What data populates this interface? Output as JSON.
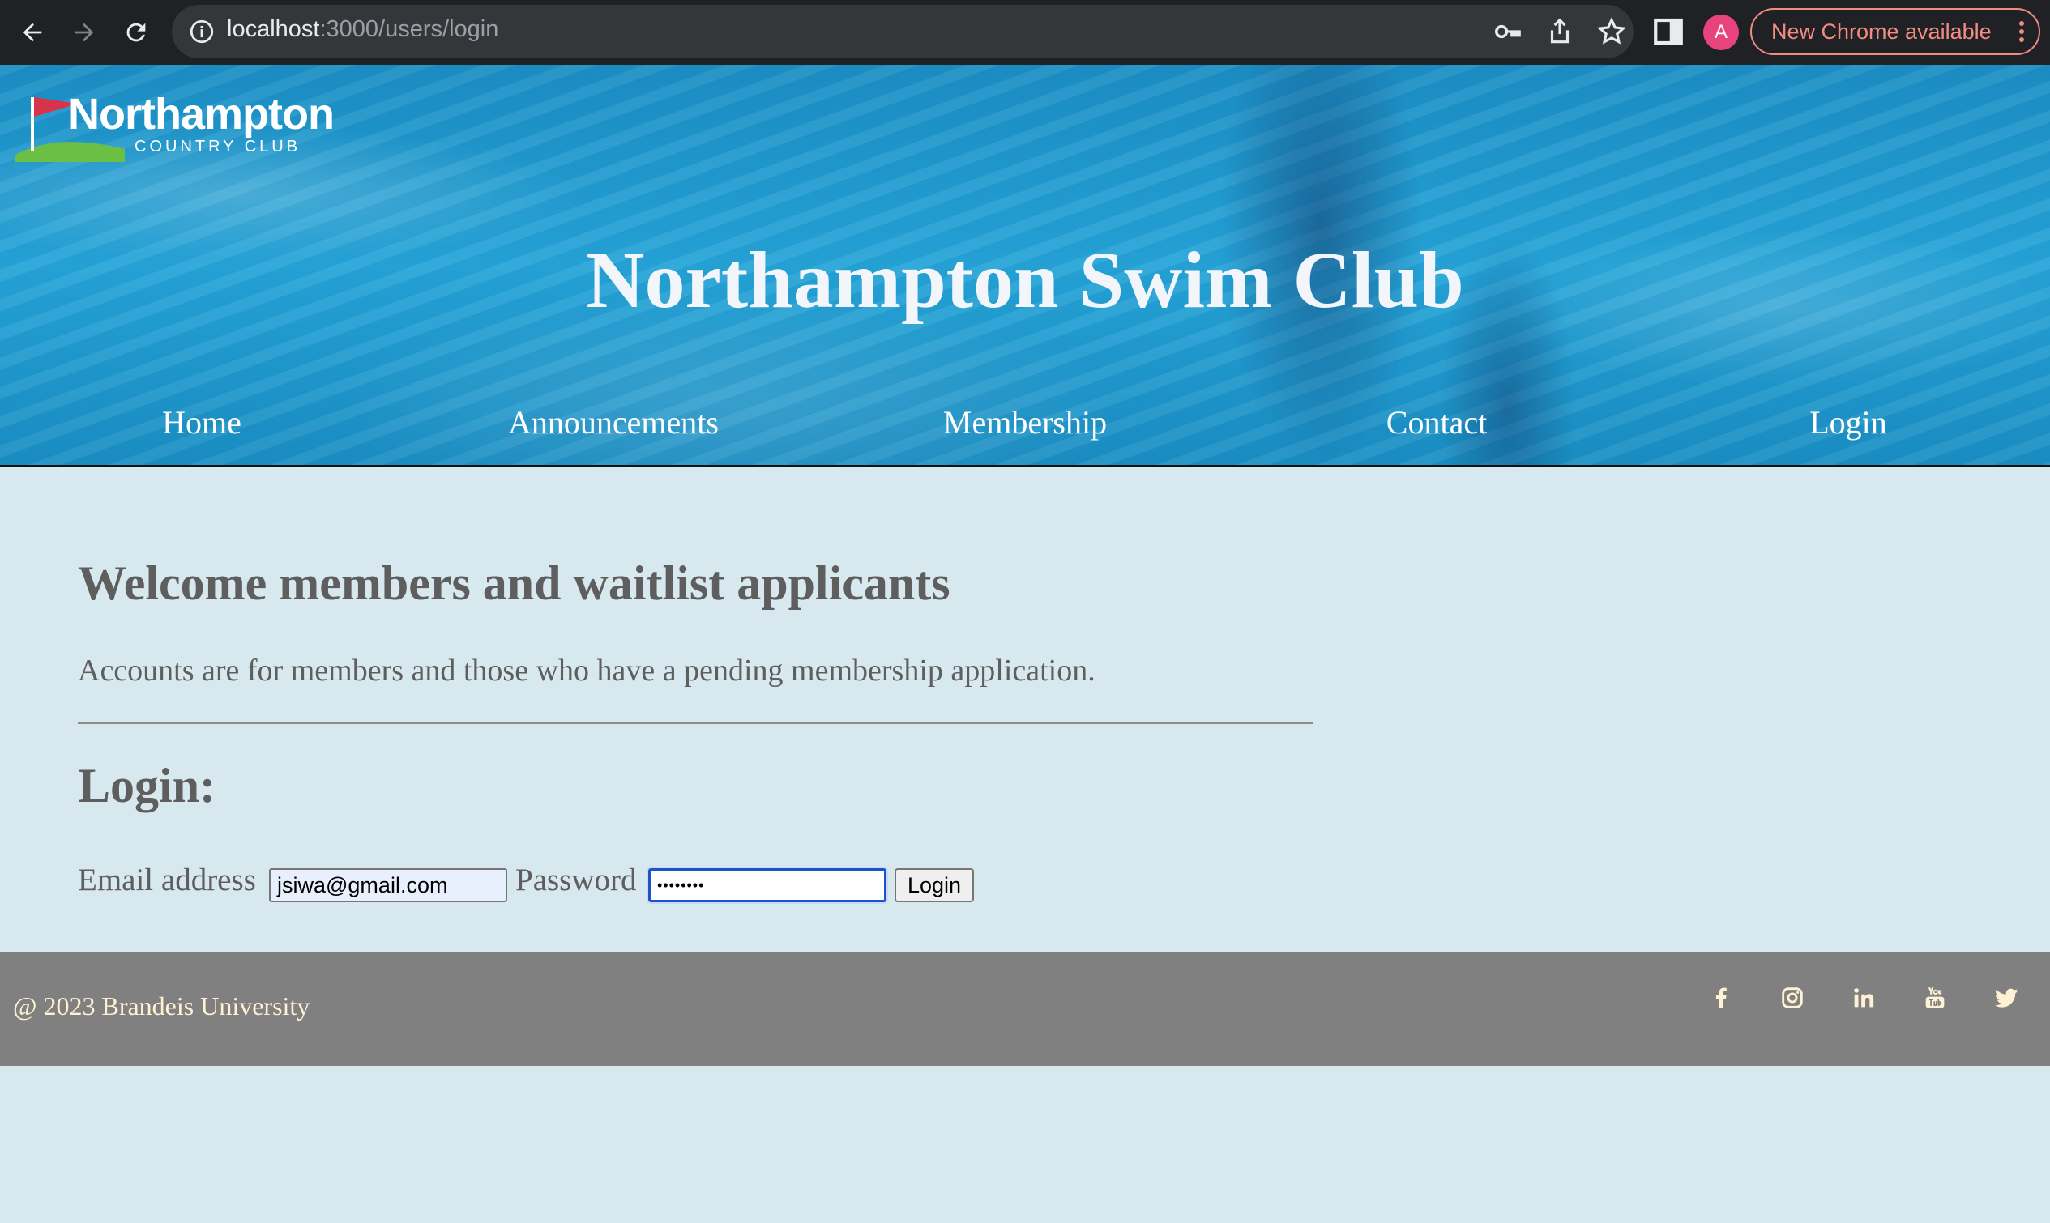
{
  "browser": {
    "url_host": "localhost",
    "url_path": ":3000/users/login",
    "profile_initial": "A",
    "update_label": "New Chrome available",
    "icons": [
      "back-icon",
      "forward-icon",
      "reload-icon",
      "info-icon",
      "key-icon",
      "share-icon",
      "star-icon",
      "side-panel-icon",
      "kebab-menu-icon"
    ]
  },
  "header": {
    "logo_text": "Northampton",
    "logo_subtext": "COUNTRY CLUB",
    "title": "Northampton Swim Club",
    "nav": [
      "Home",
      "Announcements",
      "Membership",
      "Contact",
      "Login"
    ]
  },
  "main": {
    "welcome_heading": "Welcome members and waitlist applicants",
    "intro_text": "Accounts are for members and those who have a pending membership application.",
    "login_heading": "Login:",
    "email_label": "Email address",
    "email_value": "jsiwa@gmail.com",
    "password_label": "Password",
    "password_value": "••••••••",
    "submit_label": "Login"
  },
  "footer": {
    "copyright": "@ 2023 Brandeis University",
    "social_icons": [
      "facebook-icon",
      "instagram-icon",
      "linkedin-icon",
      "youtube-icon",
      "twitter-icon"
    ]
  },
  "colors": {
    "chrome_bg": "#202124",
    "page_bg": "#d7e9ef",
    "text_gray": "#5e5e5e",
    "footer_bg": "#808080",
    "footer_text": "#fff2d4",
    "update_accent": "#f28b82"
  }
}
